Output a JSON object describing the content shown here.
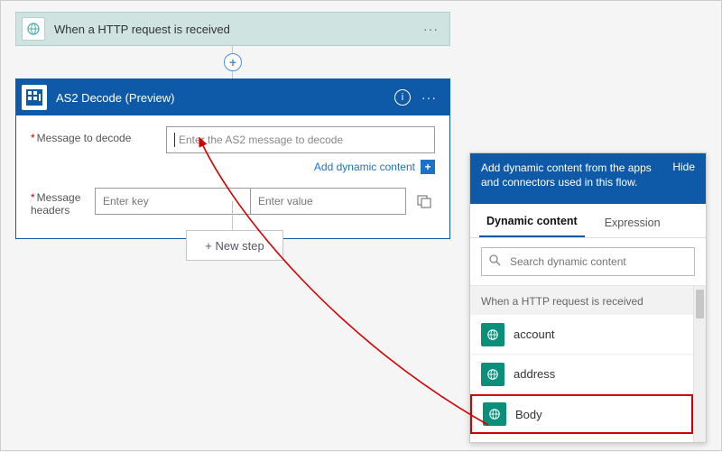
{
  "trigger": {
    "title": "When a HTTP request is received",
    "menu": "···"
  },
  "plus": "+",
  "action": {
    "title": "AS2 Decode (Preview)",
    "info": "i",
    "menu": "···",
    "fields": {
      "message_label": "Message to decode",
      "message_placeholder": "Enter the AS2 message to decode",
      "dynamic_link": "Add dynamic content",
      "headers_label": "Message headers",
      "key_placeholder": "Enter key",
      "value_placeholder": "Enter value"
    }
  },
  "newstep": "+ New step",
  "panel": {
    "head": "Add dynamic content from the apps and connectors used in this flow.",
    "hide": "Hide",
    "tabs": {
      "dynamic": "Dynamic content",
      "expression": "Expression"
    },
    "search_placeholder": "Search dynamic content",
    "group": "When a HTTP request is received",
    "tokens": [
      "account",
      "address",
      "Body"
    ]
  }
}
